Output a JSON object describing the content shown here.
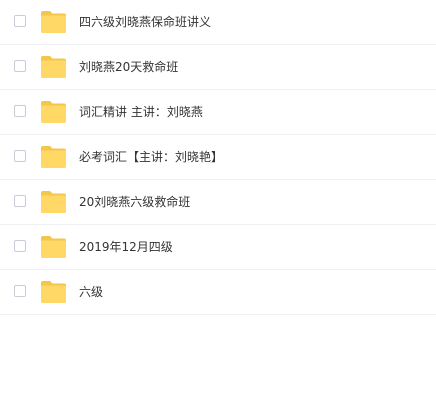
{
  "folder_icon": "folder-icon",
  "colors": {
    "folder_back": "#f5c64c",
    "folder_front": "#ffd866",
    "divider": "#f0f2f5",
    "text": "#333333"
  },
  "files": [
    {
      "name": "四六级刘晓燕保命班讲义",
      "checked": false
    },
    {
      "name": "刘晓燕20天救命班",
      "checked": false
    },
    {
      "name": "词汇精讲 主讲：刘晓燕",
      "checked": false
    },
    {
      "name": "必考词汇【主讲：刘晓艳】",
      "checked": false
    },
    {
      "name": "20刘晓燕六级救命班",
      "checked": false
    },
    {
      "name": "2019年12月四级",
      "checked": false
    },
    {
      "name": "六级",
      "checked": false
    }
  ]
}
